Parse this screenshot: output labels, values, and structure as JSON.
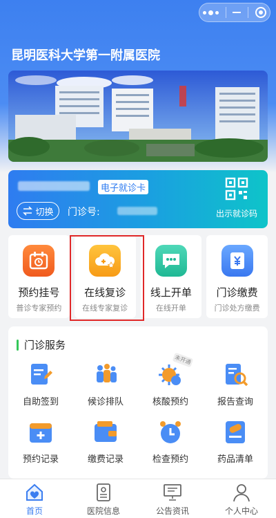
{
  "header": {
    "title": "昆明医科大学第一附属医院"
  },
  "banner": {
    "image_name": "hospital-campus-photo"
  },
  "card": {
    "ecard_label": "电子就诊卡",
    "switch_label": "切换",
    "clinic_no_label": "门诊号:",
    "show_code_label": "出示就诊码"
  },
  "quick": [
    {
      "title": "预约挂号",
      "subtitle": "普诊专家预约"
    },
    {
      "title": "在线复诊",
      "subtitle": "在线专家复诊"
    },
    {
      "title": "线上开单",
      "subtitle": "在线开单"
    },
    {
      "title": "门诊缴费",
      "subtitle": "门诊处方缴费"
    }
  ],
  "services": {
    "title": "门诊服务",
    "items": [
      {
        "label": "自助签到",
        "icon": "checkin-icon"
      },
      {
        "label": "候诊排队",
        "icon": "queue-icon"
      },
      {
        "label": "核酸预约",
        "icon": "virus-icon",
        "badge": "未开通"
      },
      {
        "label": "报告查询",
        "icon": "report-icon"
      },
      {
        "label": "预约记录",
        "icon": "calendar-icon"
      },
      {
        "label": "缴费记录",
        "icon": "wallet-icon"
      },
      {
        "label": "检查预约",
        "icon": "clock-icon"
      },
      {
        "label": "药品清单",
        "icon": "pill-icon"
      }
    ]
  },
  "tabbar": [
    {
      "label": "首页",
      "icon": "home-icon",
      "active": true
    },
    {
      "label": "医院信息",
      "icon": "hospital-info-icon"
    },
    {
      "label": "公告资讯",
      "icon": "announcement-icon"
    },
    {
      "label": "个人中心",
      "icon": "user-icon"
    }
  ],
  "colors": {
    "primary": "#3a7df0",
    "highlight": "#e02828"
  }
}
